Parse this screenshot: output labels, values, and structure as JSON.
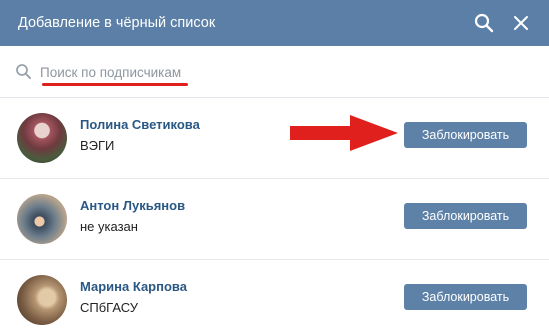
{
  "dialog": {
    "title": "Добавление в чёрный список",
    "header_icons": [
      "search-icon",
      "close-icon"
    ]
  },
  "search": {
    "placeholder": "Поиск по подписчикам",
    "value": ""
  },
  "users": [
    {
      "name": "Полина Светикова",
      "subtitle": "ВЭГИ",
      "button": "Заблокировать"
    },
    {
      "name": "Антон Лукьянов",
      "subtitle": "не указан",
      "button": "Заблокировать"
    },
    {
      "name": "Марина Карпова",
      "subtitle": "СПбГАСУ",
      "button": "Заблокировать"
    }
  ],
  "colors": {
    "header_bg": "#5b7fa6",
    "button_bg": "#5e81a8",
    "name_link": "#2a5885",
    "annotation_red": "#e0201c"
  }
}
